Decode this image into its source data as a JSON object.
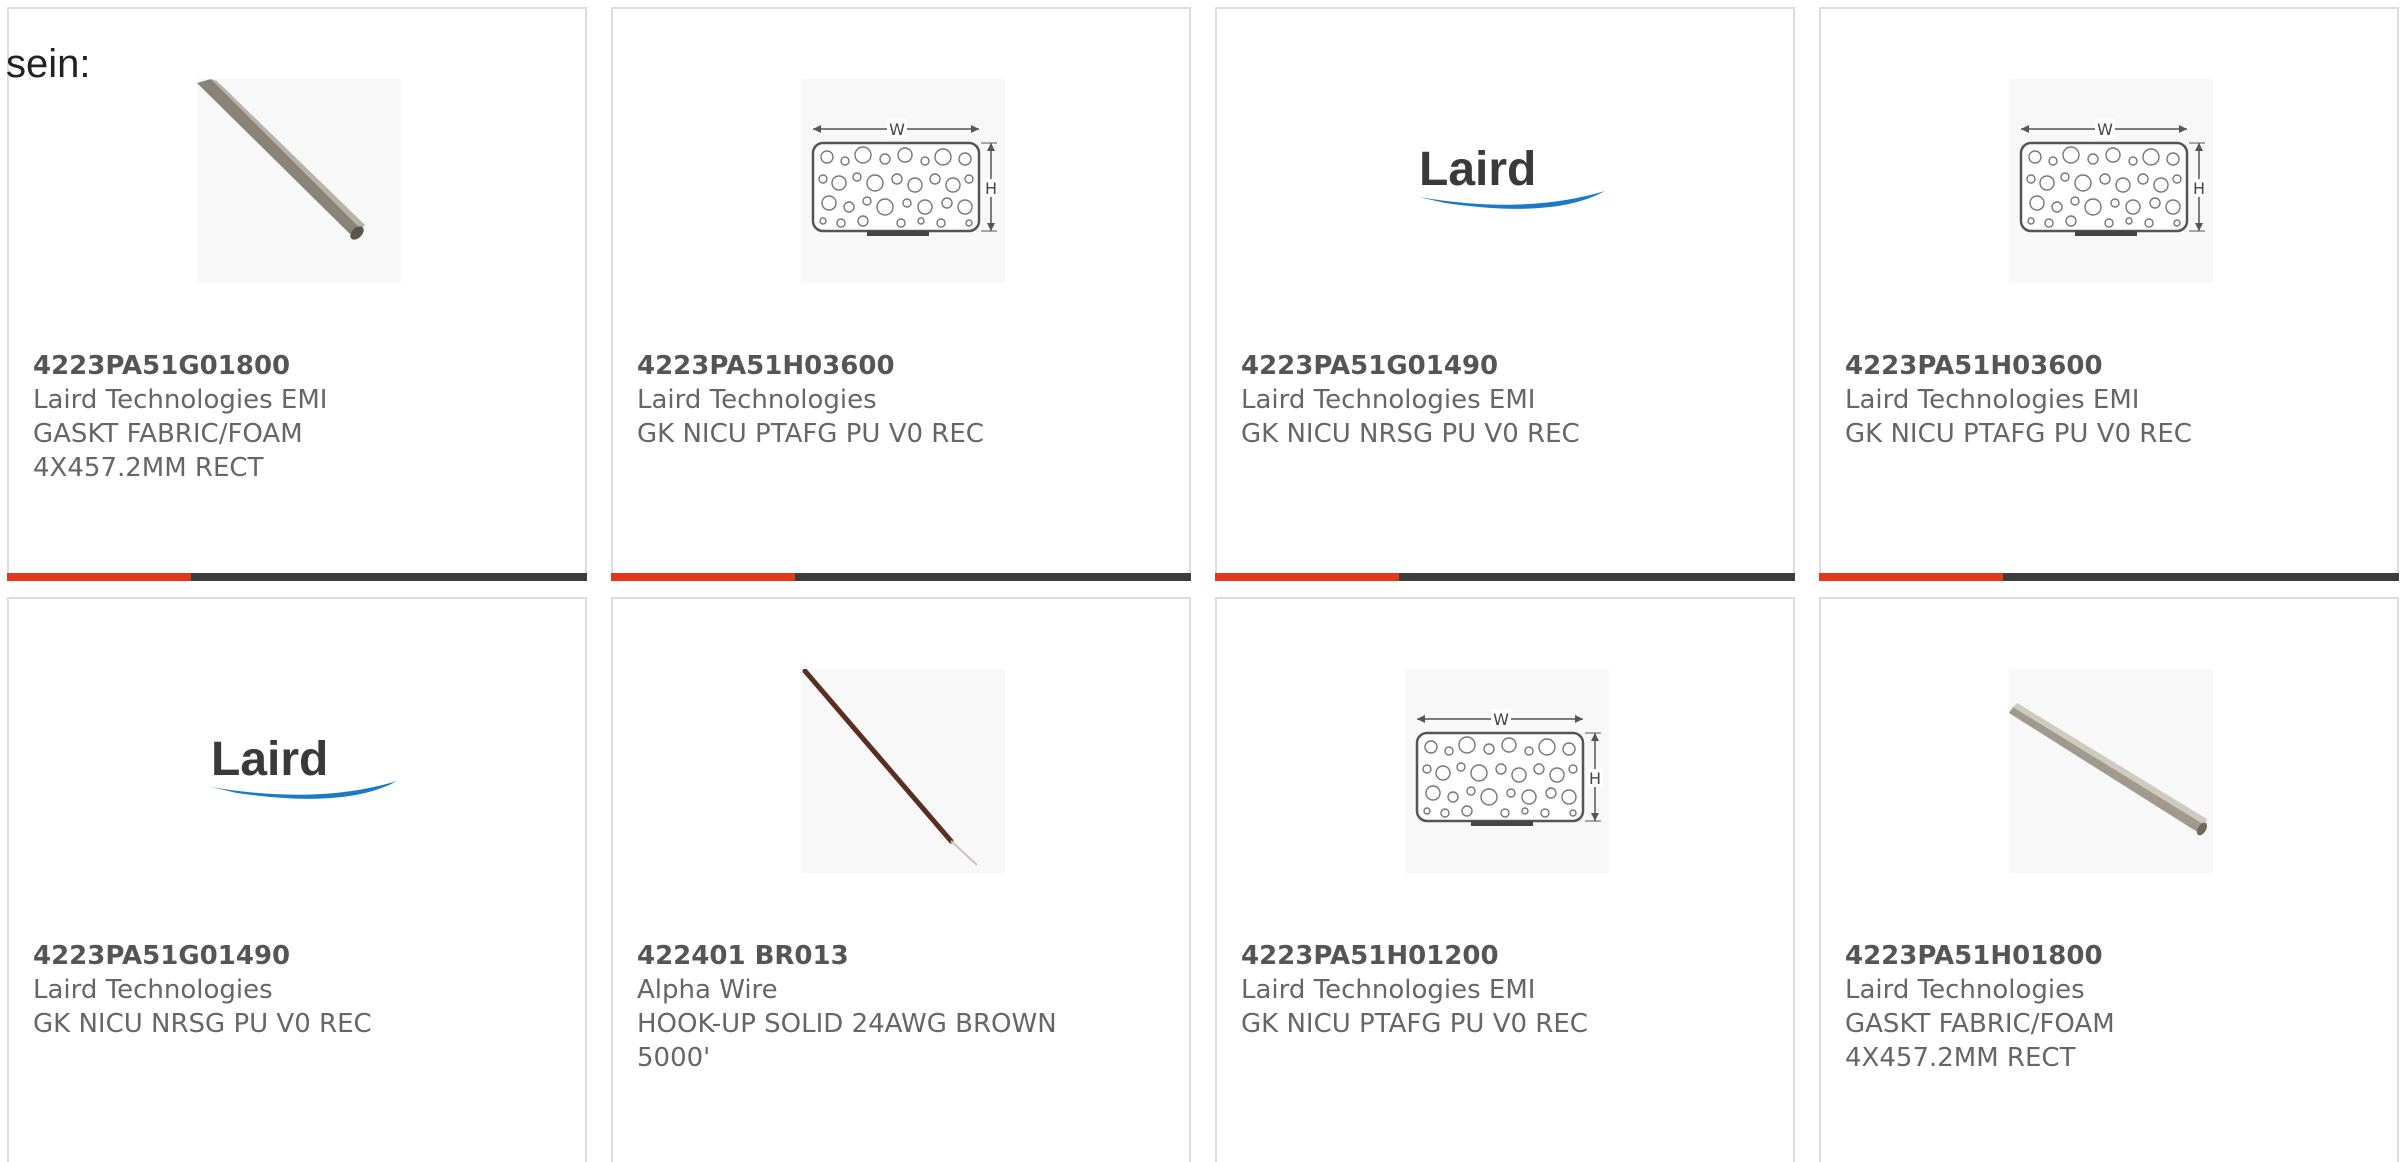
{
  "intro_text": "sein:",
  "colors": {
    "accent": "#e2371b",
    "bar": "#3d3d3d",
    "border": "#dddddd",
    "text": "#666666",
    "laird_blue": "#1a7bc4"
  },
  "products": [
    {
      "part": "4223PA51G01800",
      "maker": "Laird Technologies EMI",
      "desc": "GASKT FABRIC/FOAM 4X457.2MM RECT",
      "image": "gasket-strip-icon"
    },
    {
      "part": "4223PA51H03600",
      "maker": "Laird Technologies",
      "desc": "GK NICU PTAFG PU V0 REC",
      "image": "gasket-diagram-icon"
    },
    {
      "part": "4223PA51G01490",
      "maker": "Laird Technologies EMI",
      "desc": "GK NICU NRSG PU V0 REC",
      "image": "laird-logo"
    },
    {
      "part": "4223PA51H03600",
      "maker": "Laird Technologies EMI",
      "desc": "GK NICU PTAFG PU V0 REC",
      "image": "gasket-diagram-icon"
    },
    {
      "part": "4223PA51G01490",
      "maker": "Laird Technologies",
      "desc": "GK NICU NRSG PU V0 REC",
      "image": "laird-logo"
    },
    {
      "part": "422401 BR013",
      "maker": "Alpha Wire",
      "desc": "HOOK-UP SOLID 24AWG BROWN 5000'",
      "image": "wire-icon"
    },
    {
      "part": "4223PA51H01200",
      "maker": "Laird Technologies EMI",
      "desc": "GK NICU PTAFG PU V0 REC",
      "image": "gasket-diagram-icon"
    },
    {
      "part": "4223PA51H01800",
      "maker": "Laird Technologies",
      "desc": "GASKT FABRIC/FOAM 4X457.2MM RECT",
      "image": "gasket-strip-icon"
    }
  ]
}
